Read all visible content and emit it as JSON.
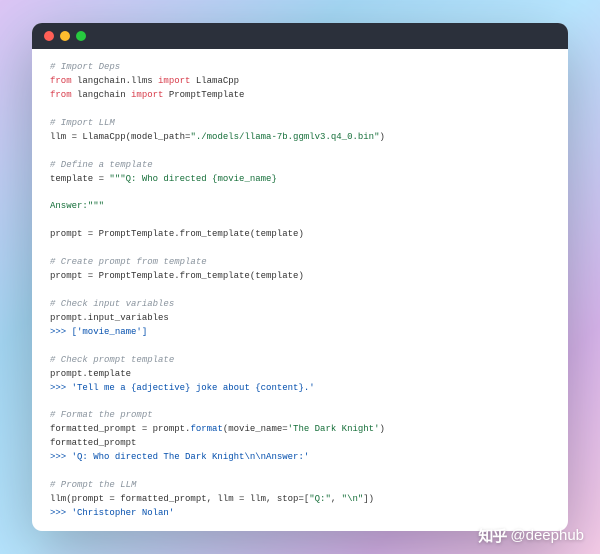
{
  "window": {
    "dots": [
      "close",
      "minimize",
      "zoom"
    ]
  },
  "code": {
    "c1": "# Import Deps",
    "l1a": "from",
    "l1b": " langchain.llms ",
    "l1c": "import",
    "l1d": " LlamaCpp",
    "l2a": "from",
    "l2b": " langchain ",
    "l2c": "import",
    "l2d": " PromptTemplate",
    "c2": "# Import LLM",
    "l3a": "llm = LlamaCpp(model_path=",
    "l3b": "\"./models/llama-7b.ggmlv3.q4_0.bin\"",
    "l3c": ")",
    "c3": "# Define a template",
    "l4a": "template = ",
    "l4b": "\"\"\"Q: Who directed {movie_name}",
    "l5": "Answer:\"\"\"",
    "l6a": "prompt = PromptTemplate.from_template(template)",
    "c4": "# Create prompt from template",
    "l7a": "prompt = PromptTemplate.from_template(template)",
    "c5": "# Check input variables",
    "l8": "prompt.input_variables",
    "r1a": ">>> ",
    "r1b": "['movie_name']",
    "c6": "# Check prompt template",
    "l9": "prompt.template",
    "r2a": ">>> ",
    "r2b": "'Tell me a {adjective} joke about {content}.'",
    "c7": "# Format the prompt",
    "l10a": "formatted_prompt = prompt.",
    "l10b": "format",
    "l10c": "(movie_name=",
    "l10d": "'The Dark Knight'",
    "l10e": ")",
    "l11": "formatted_prompt",
    "r3a": ">>> ",
    "r3b": "'Q: Who directed The Dark Knight\\n\\nAnswer:'",
    "c8": "# Prompt the LLM",
    "l12a": "llm(prompt = formatted_prompt, llm = llm, stop=[",
    "l12b": "\"Q:\"",
    "l12c": ", ",
    "l12d": "\"\\n\"",
    "l12e": "])",
    "r4a": ">>> ",
    "r4b": "'Christopher Nolan'"
  },
  "watermark": {
    "brand": "知乎",
    "handle": "@deephub"
  }
}
